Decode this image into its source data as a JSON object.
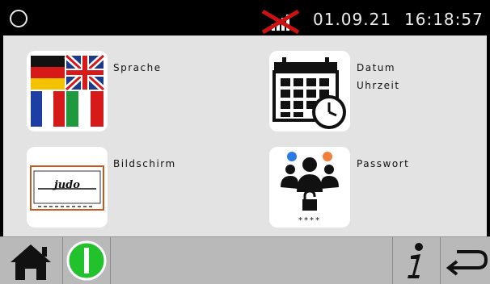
{
  "status_bar": {
    "date": "01.09.21",
    "time": "16:18:57"
  },
  "menu": {
    "language_label": "Sprache",
    "datetime_label_1": "Datum",
    "datetime_label_2": "Uhrzeit",
    "screen_label": "Bildschirm",
    "password_label": "Passwort",
    "screen_logo_text": "judo",
    "password_mask": "****"
  },
  "colors": {
    "status_bg": "#000000",
    "panel_bg": "#e3e3e3",
    "bottom_bar": "#b9b9b9",
    "power_green": "#21c22b",
    "signal_cross": "#cc1111"
  }
}
